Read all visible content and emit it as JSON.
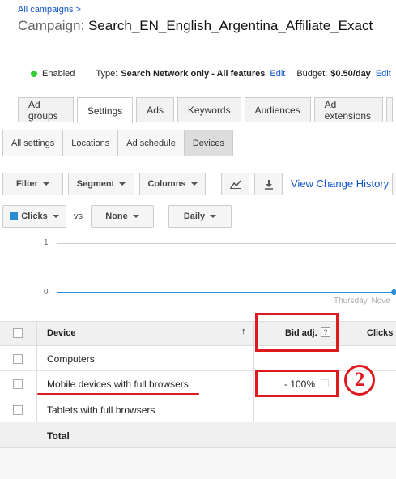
{
  "breadcrumb": "All campaigns >",
  "campaign": {
    "label": "Campaign:",
    "name": "Search_EN_English_Argentina_Affiliate_Exact"
  },
  "status": {
    "enabled": "Enabled",
    "type_label": "Type:",
    "type_value": "Search Network only - All features",
    "type_edit": "Edit",
    "budget_label": "Budget:",
    "budget_value": "$0.50/day",
    "budget_edit": "Edit"
  },
  "tabs": [
    "Ad groups",
    "Settings",
    "Ads",
    "Keywords",
    "Audiences",
    "Ad extensions"
  ],
  "subtabs": [
    "All settings",
    "Locations",
    "Ad schedule",
    "Devices"
  ],
  "toolbar": {
    "filter": "Filter",
    "segment": "Segment",
    "columns": "Columns",
    "view_history": "View Change History"
  },
  "chart_controls": {
    "metric1": "Clicks",
    "vs": "vs",
    "metric2": "None",
    "period": "Daily"
  },
  "chart": {
    "y_top": "1",
    "y_bottom": "0",
    "x_label": "Thursday, Nove"
  },
  "table": {
    "headers": {
      "device": "Device",
      "bid_adj": "Bid adj.",
      "clicks": "Clicks",
      "help": "?"
    },
    "rows": [
      {
        "device": "Computers",
        "bid": ""
      },
      {
        "device": "Mobile devices with full browsers",
        "bid": "- 100%"
      },
      {
        "device": "Tablets with full browsers",
        "bid": ""
      }
    ],
    "total": "Total"
  },
  "annotation": {
    "number": "2"
  },
  "colors": {
    "accent_red": "#e0191f",
    "link": "#15c",
    "clicks_series": "#2a8dd4"
  }
}
